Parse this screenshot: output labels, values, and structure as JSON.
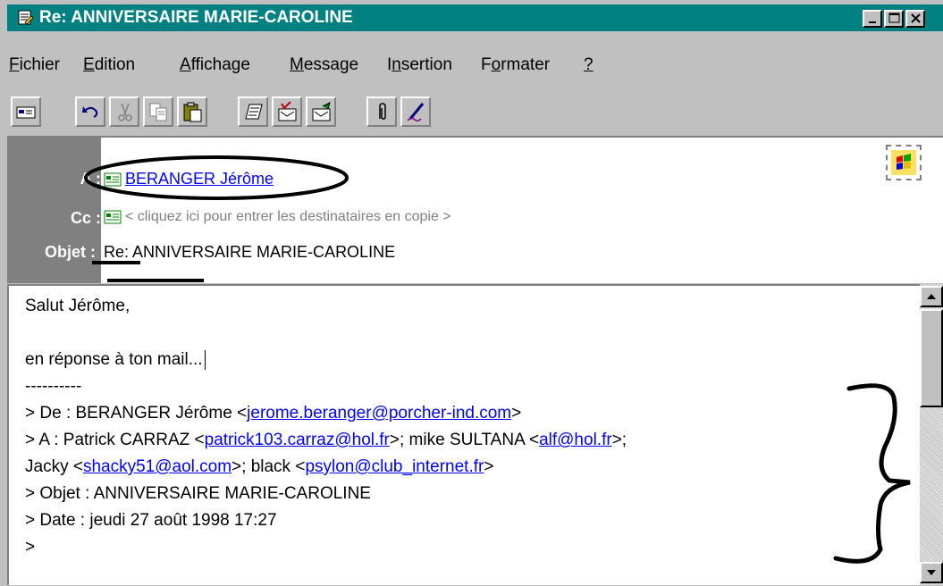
{
  "window": {
    "title": "Re: ANNIVERSAIRE MARIE-CAROLINE",
    "title_color": "#008080"
  },
  "menu": [
    {
      "ul": "F",
      "rest": "ichier"
    },
    {
      "ul": "E",
      "rest": "dition"
    },
    {
      "ul": "A",
      "rest": "ffichage"
    },
    {
      "ul": "M",
      "rest": "essage"
    },
    {
      "pre": "I",
      "ul": "n",
      "rest": "sertion"
    },
    {
      "pre": "F",
      "ul": "o",
      "rest": "rmater"
    },
    {
      "ul": "?",
      "rest": ""
    }
  ],
  "toolbar": {
    "icons": [
      "send-icon",
      "undo-icon",
      "cut-icon",
      "copy-icon",
      "paste-icon",
      "address-book-icon",
      "check-names-icon",
      "select-recipients-icon",
      "attach-icon",
      "signature-icon"
    ]
  },
  "header": {
    "to_label": "A :",
    "to_value": "BERANGER Jérôme",
    "cc_label": "Cc :",
    "cc_placeholder": "< cliquez ici pour entrer les destinataires en copie >",
    "subject_label": "Objet :",
    "subject_prefix": "Re:",
    "subject_value": " ANNIVERSAIRE MARIE-CAROLINE"
  },
  "body": {
    "greeting": "Salut Jérôme,",
    "reply_line": "en réponse à ton mail...",
    "separator": "----------",
    "from_prefix": "> De : BERANGER Jérôme <",
    "from_email": "jerome.beranger@porcher-ind.com",
    "from_suffix": ">",
    "to_prefix": "> A : Patrick CARRAZ <",
    "to_email1": "patrick103.carraz@hol.fr",
    "to_mid1": ">; mike SULTANA <",
    "to_email2": "alf@hol.fr",
    "to_mid2": ">;",
    "cont_prefix": "Jacky <",
    "cont_email1": "shacky51@aol.com",
    "cont_mid": ">; black <",
    "cont_email2": "psylon@club_internet.fr",
    "cont_suffix": ">",
    "subject_line": "> Objet : ANNIVERSAIRE MARIE-CAROLINE",
    "date_line": "> Date : jeudi 27 août 1998 17:27",
    "last_line": ">"
  }
}
